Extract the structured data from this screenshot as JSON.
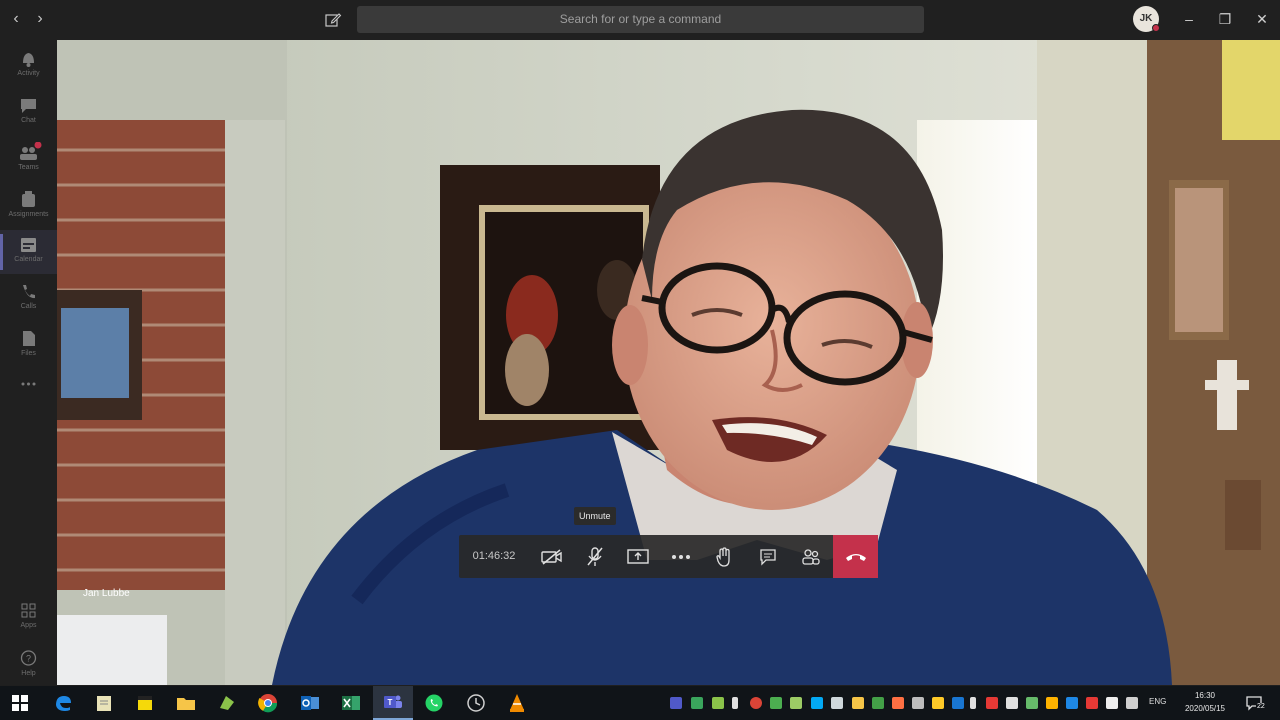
{
  "titlebar": {
    "search_placeholder": "Search for or type a command",
    "user_initials": "JK"
  },
  "rail": {
    "items": [
      {
        "label": "Activity"
      },
      {
        "label": "Chat"
      },
      {
        "label": "Teams"
      },
      {
        "label": "Assignments"
      },
      {
        "label": "Calendar"
      },
      {
        "label": "Calls"
      },
      {
        "label": "Files"
      },
      {
        "label": "Apps"
      },
      {
        "label": "Help"
      }
    ],
    "active": "Calendar"
  },
  "call": {
    "participant_name": "Jan Lubbe",
    "timer": "01:46:32",
    "tooltip": "Unmute"
  },
  "taskbar": {
    "language": "ENG",
    "time": "16:30",
    "date": "2020/05/15",
    "notification_count": "22"
  },
  "colors": {
    "accent": "#6264a7",
    "hangup": "#c4314b"
  }
}
